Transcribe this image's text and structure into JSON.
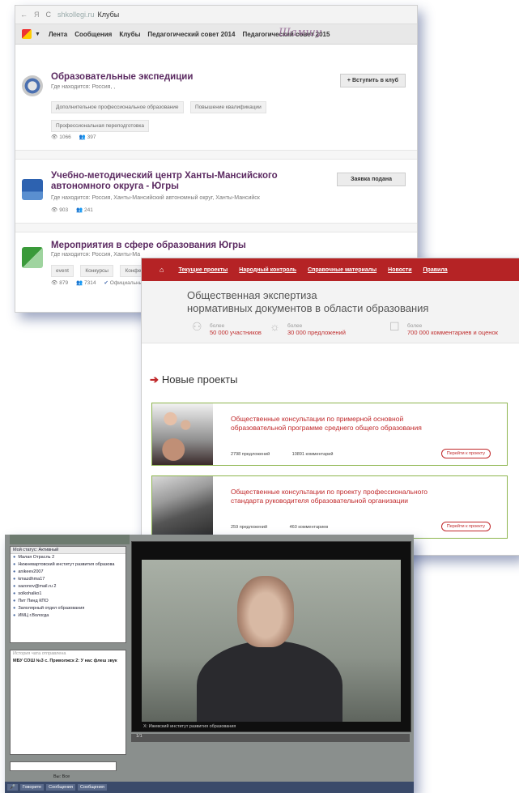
{
  "clubs_window": {
    "browser": {
      "back": "←",
      "ya": "Я",
      "reload": "C",
      "site": "shkollegi.ru",
      "path": "Клубы"
    },
    "nav": {
      "items": [
        "Лента",
        "Сообщения",
        "Клубы",
        "Педагогический совет 2014",
        "Педагогический совет 2015"
      ]
    },
    "clubs": [
      {
        "title": "Образовательные экспедиции",
        "where": "Где находится: Россия, ,",
        "button": "+ Вступить в клуб",
        "tags": [
          "Дополнительное профессиональное образование",
          "Повышение квалификации",
          "Профессиональная переподготовка"
        ],
        "views": "1066",
        "members": "397"
      },
      {
        "title": "Учебно-методический центр Ханты-Мансийского автономного округа - Югры",
        "where": "Где находится: Россия, Ханты-Мансийский автономный округ, Ханты-Мансийск",
        "button": "Заявка подана",
        "views": "903",
        "members": "241"
      },
      {
        "title": "Мероприятия в сфере образования Югры",
        "where": "Где находится: Россия, Ханты-Ма",
        "tags": [
          "event",
          "Конкурсы",
          "Конфер"
        ],
        "views": "879",
        "members": "7314",
        "official": "Официальны"
      }
    ]
  },
  "expertise_window": {
    "nav": [
      "Текущие проекты",
      "Народный контроль",
      "Справочные материалы",
      "Новости",
      "Правила"
    ],
    "hero_line1": "Общественная экспертиза",
    "hero_line2": "нормативных документов в области образования",
    "stats": [
      {
        "prefix": "более",
        "value": "50 000 участников"
      },
      {
        "prefix": "более",
        "value": "30 000 предложений"
      },
      {
        "prefix": "более",
        "value": "700 000 комментариев и оценок"
      }
    ],
    "section_title": "Новые проекты",
    "projects": [
      {
        "title": "Общественные консультации по примерной основной образовательной программе среднего общего образования",
        "proposals": "2798 предложений",
        "comments": "10891 комментарий",
        "button": "Перейти к проекту"
      },
      {
        "title": "Общественные консультации по проекту профессионального стандарта руководителя образовательной организации",
        "proposals": "259 предложений",
        "comments": "460 комментариев",
        "button": "Перейти к проекту"
      }
    ]
  },
  "conference_window": {
    "users_header": "Мой статус: Активный",
    "users": [
      "Малая Отрасль 2",
      "Нижневартовский институт развития образова",
      "anikeev2007",
      "kmazdhma17",
      "sazonov@mail.ru 2",
      "solkohalko1",
      "Пит Пинд КПО",
      "Заполярный отдел образования",
      "ИМЦ г.Вологда"
    ],
    "chat_header": "История чата отправлена",
    "chat_message": "МБУ СОШ №3 с. Приволжск 2: У нас флеш звук",
    "chat_select": "Вы: Все",
    "video_caption": "Х: Ижевский институт развития образования",
    "video_bar": "1/1",
    "taskbar": [
      "Говорите",
      "Сообщения",
      "Сообщения"
    ]
  }
}
